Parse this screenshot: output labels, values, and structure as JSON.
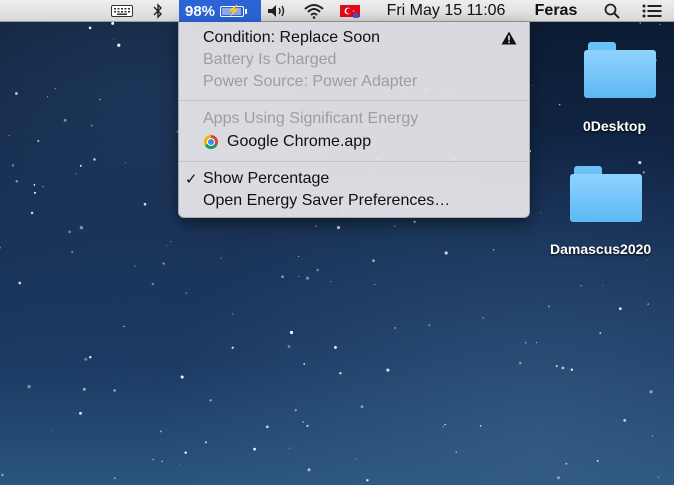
{
  "menubar": {
    "battery_percent": "98%",
    "clock": "Fri May 15  11:06",
    "user": "Feras"
  },
  "battery_menu": {
    "condition": "Condition: Replace Soon",
    "battery_status": "Battery Is Charged",
    "power_source": "Power Source: Power Adapter",
    "apps_heading": "Apps Using Significant Energy",
    "app_name": "Google Chrome.app",
    "show_percentage": "Show Percentage",
    "show_percentage_checked": true,
    "open_prefs": "Open Energy Saver Preferences…"
  },
  "desktop": {
    "items": [
      {
        "label": "0Desktop",
        "icon": "folder-icon"
      },
      {
        "label": "Damascus2020",
        "icon": "folder-icon"
      }
    ]
  },
  "colors": {
    "menu_highlight": "#2c64d6",
    "folder": "#6cc2f7"
  }
}
